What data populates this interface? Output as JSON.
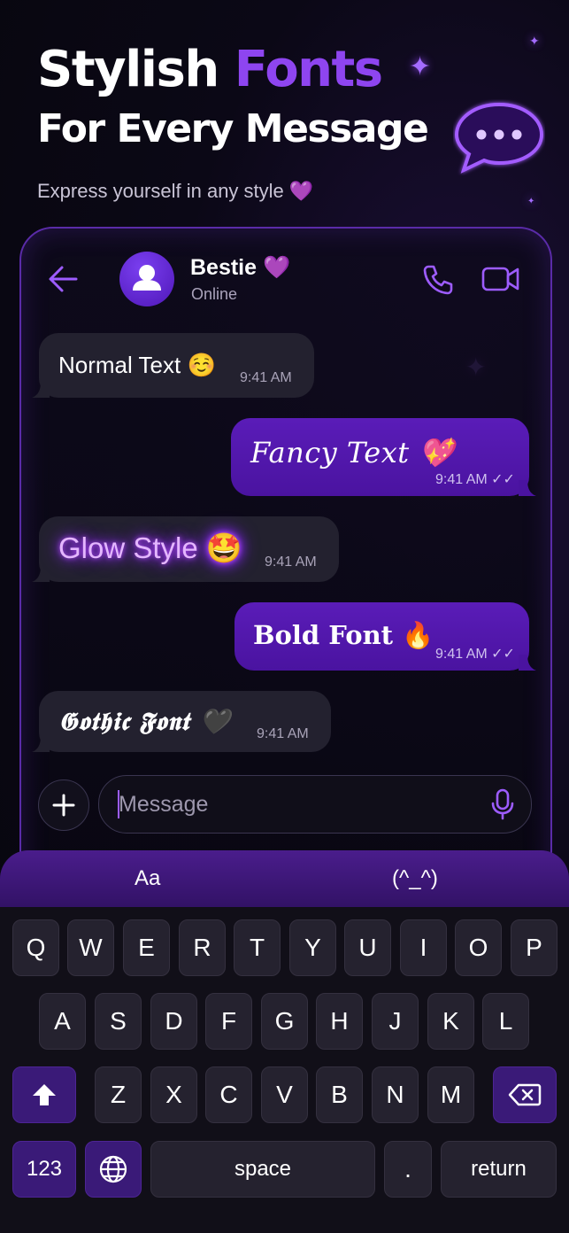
{
  "promo": {
    "title_line1_a": "Stylish",
    "title_line1_b": "Fonts",
    "title_line2": "For Every Message",
    "subtitle": "Express yourself in any style 💜"
  },
  "colors": {
    "accent": "#8e45f0",
    "bubble_out": "#5a1cb8",
    "bubble_in": "#23212f",
    "background": "#07060d"
  },
  "chat": {
    "contact_name": "Bestie 💜",
    "contact_status": "Online",
    "icons": [
      "back-arrow-icon",
      "avatar-icon",
      "phone-icon",
      "video-icon"
    ]
  },
  "messages": [
    {
      "direction": "incoming",
      "text": "Normal Text ☺️",
      "time": "9:41 AM",
      "style": "normal"
    },
    {
      "direction": "outgoing",
      "text": "Fancy Text 💖",
      "time": "9:41 AM ✓✓",
      "style": "fancy"
    },
    {
      "direction": "incoming",
      "text": "Glow Style 🤩",
      "time": "9:41 AM",
      "style": "glow"
    },
    {
      "direction": "outgoing",
      "text": "Bold Font 🔥",
      "time": "9:41 AM ✓✓",
      "style": "bold"
    },
    {
      "direction": "incoming",
      "text": "𝕲𝖔𝖙𝖍𝖎𝖈 𝕱𝖔𝖓𝖙 🖤",
      "time": "9:41 AM",
      "style": "gothic"
    }
  ],
  "composer": {
    "placeholder": "Message"
  },
  "keyboard": {
    "tabs": [
      "Aa",
      "(^_^)"
    ],
    "row1": [
      "Q",
      "W",
      "E",
      "R",
      "T",
      "Y",
      "U",
      "I",
      "O",
      "P"
    ],
    "row2": [
      "A",
      "S",
      "D",
      "F",
      "G",
      "H",
      "J",
      "K",
      "L"
    ],
    "row3": [
      "Z",
      "X",
      "C",
      "V",
      "B",
      "N",
      "M"
    ],
    "numbers_label": "123",
    "space_label": "space",
    "period_label": ".",
    "return_label": "return"
  }
}
